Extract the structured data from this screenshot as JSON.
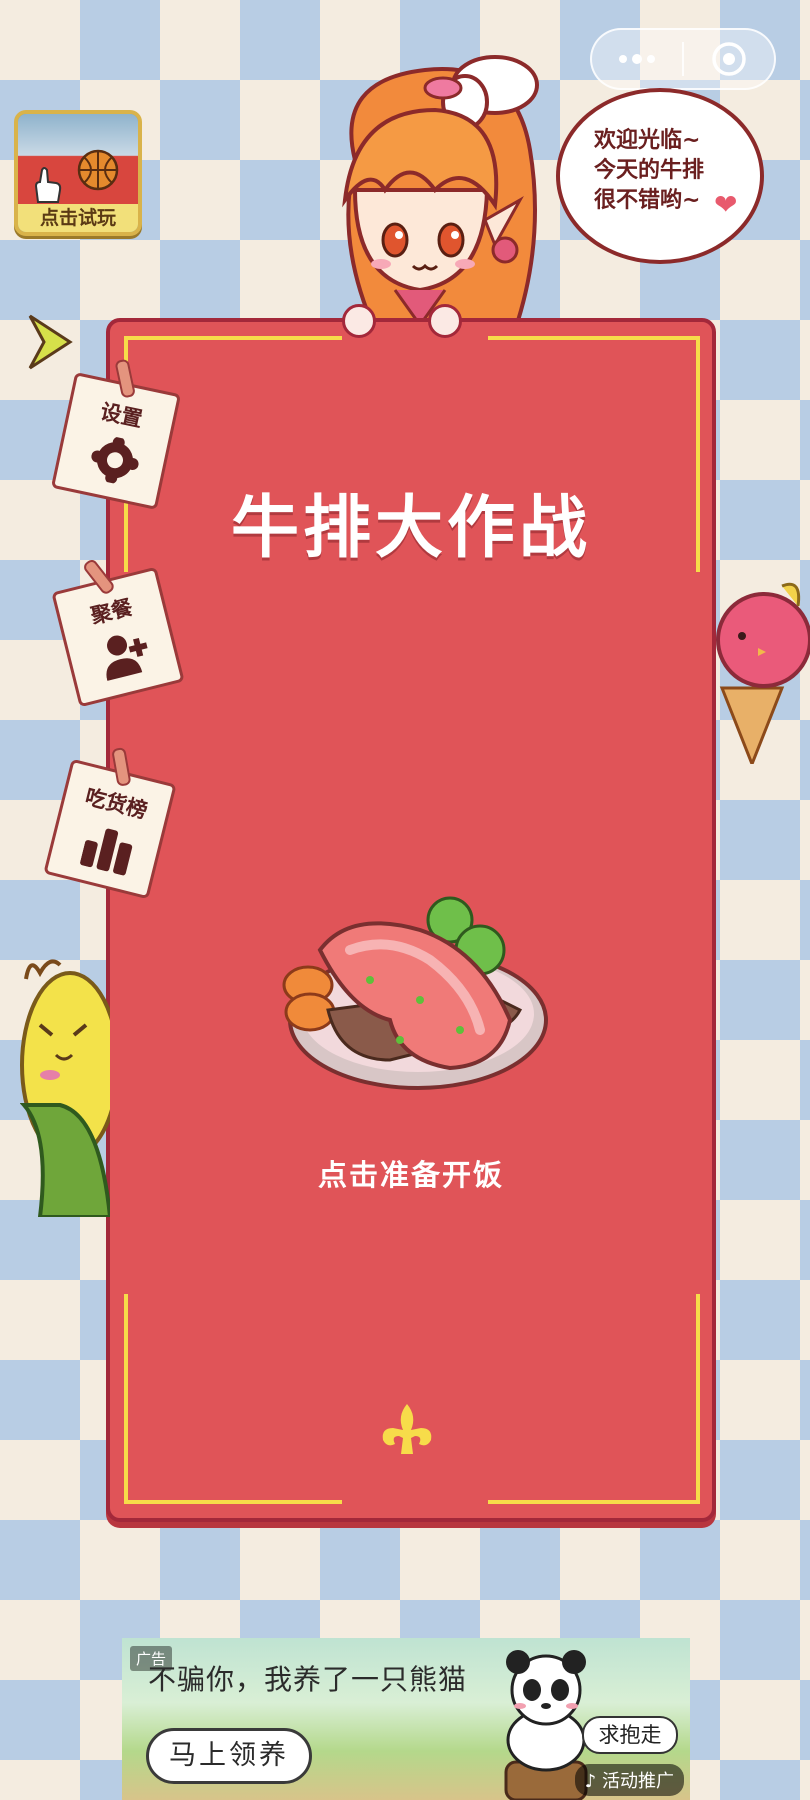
{
  "capsule": {
    "more_icon": "more-dots-icon",
    "close_icon": "target-circle-icon"
  },
  "trial": {
    "label": "点击试玩",
    "icon": "basketball-icon"
  },
  "chef": {
    "speech": "欢迎光临~\n今天的牛排\n很不错哟~",
    "heart_icon": "heart-icon"
  },
  "board": {
    "title": "牛排大作战",
    "start_label": "点击准备开饭",
    "ornament": "fleur-de-lis-icon"
  },
  "side_menu": {
    "arrow_icon": "arrow-right-icon",
    "items": [
      {
        "label": "设置",
        "icon": "gear-icon"
      },
      {
        "label": "聚餐",
        "icon": "add-user-icon"
      },
      {
        "label": "吃货榜",
        "icon": "bar-chart-icon"
      }
    ]
  },
  "ad": {
    "badge": "广告",
    "headline": "不骗你，我养了一只熊猫",
    "cta": "马上领养",
    "speech": "求抱走",
    "source": "活动推广"
  },
  "colors": {
    "board": "#e05458",
    "board_border": "#a3283a",
    "frame": "#f7dc4a",
    "checker_blue": "#b8cde4",
    "checker_cream": "#f4ece0"
  }
}
